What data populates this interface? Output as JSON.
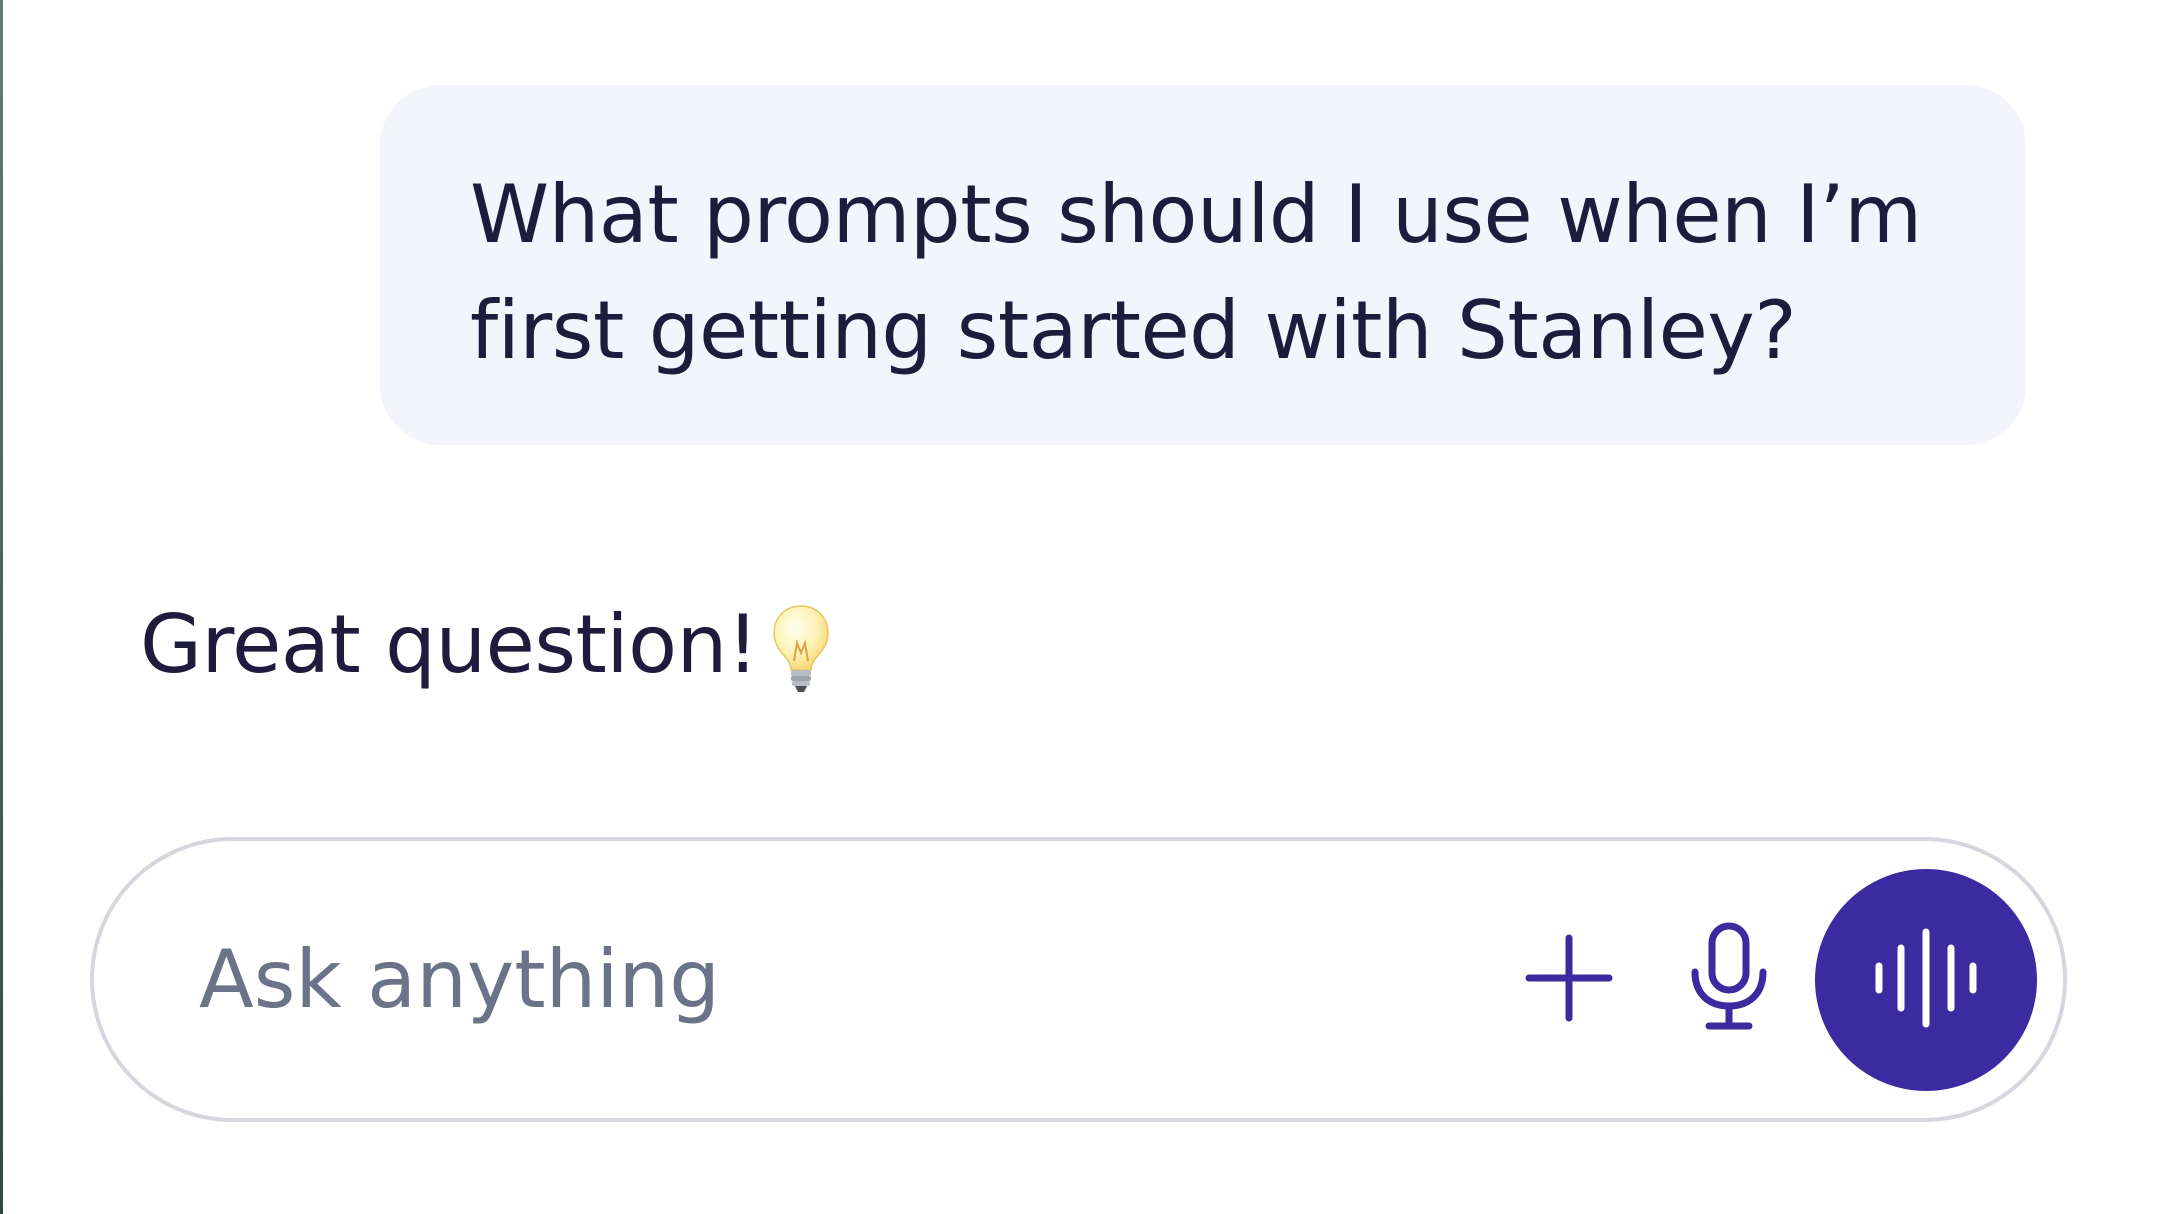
{
  "conversation": {
    "user_message": "What prompts should I use when I’m\nfirst getting started with Stanley?",
    "assistant_message": "Great question!"
  },
  "composer": {
    "placeholder": "Ask anything",
    "value": ""
  },
  "icons": {
    "assistant_emoji": "light-bulb-icon",
    "add": "plus-icon",
    "mic": "microphone-icon",
    "voice": "voice-waveform-icon"
  },
  "colors": {
    "text": "#1e1b3d",
    "bubble_bg": "#f4f4fd",
    "accent": "#3c2aa0",
    "placeholder": "#6b7388",
    "composer_border": "#d5d6de"
  }
}
